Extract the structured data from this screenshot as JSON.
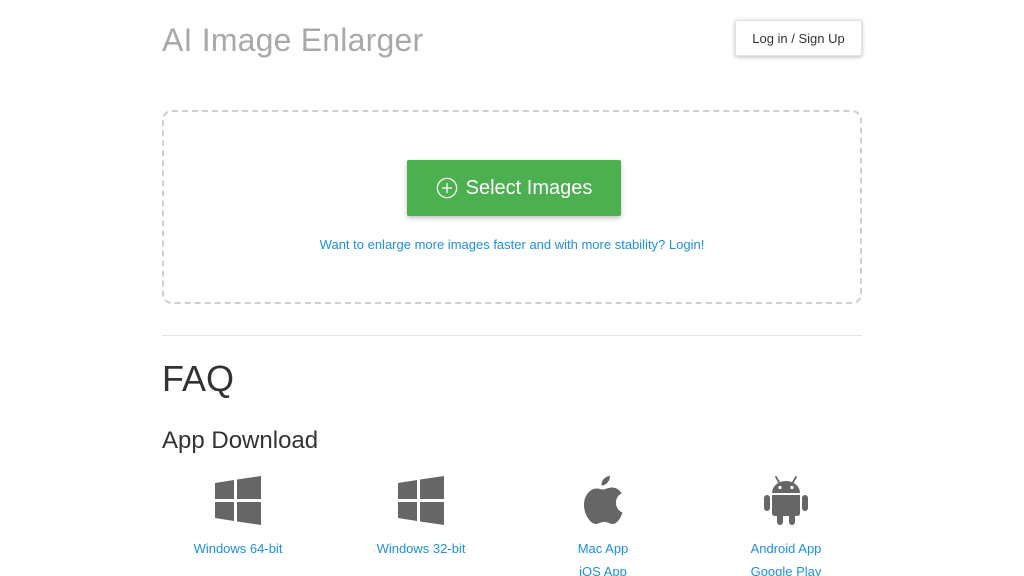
{
  "header": {
    "title": "AI Image Enlarger",
    "login_label": "Log in / Sign Up"
  },
  "upload": {
    "button_label": "Select Images",
    "hint_text": "Want to enlarge more images faster and with more stability? Login!"
  },
  "faq": {
    "heading": "FAQ"
  },
  "app_download": {
    "heading": "App Download",
    "items": [
      {
        "icon": "windows-icon",
        "links": [
          "Windows 64-bit"
        ]
      },
      {
        "icon": "windows-icon",
        "links": [
          "Windows 32-bit"
        ]
      },
      {
        "icon": "apple-icon",
        "links": [
          "Mac App",
          "iOS App"
        ]
      },
      {
        "icon": "android-icon",
        "links": [
          "Android App",
          "Google Play"
        ]
      }
    ]
  },
  "colors": {
    "accent_green": "#4caf50",
    "link_blue": "#1e8fe1",
    "title_gray": "#a9a9a9",
    "icon_gray": "#666666"
  }
}
